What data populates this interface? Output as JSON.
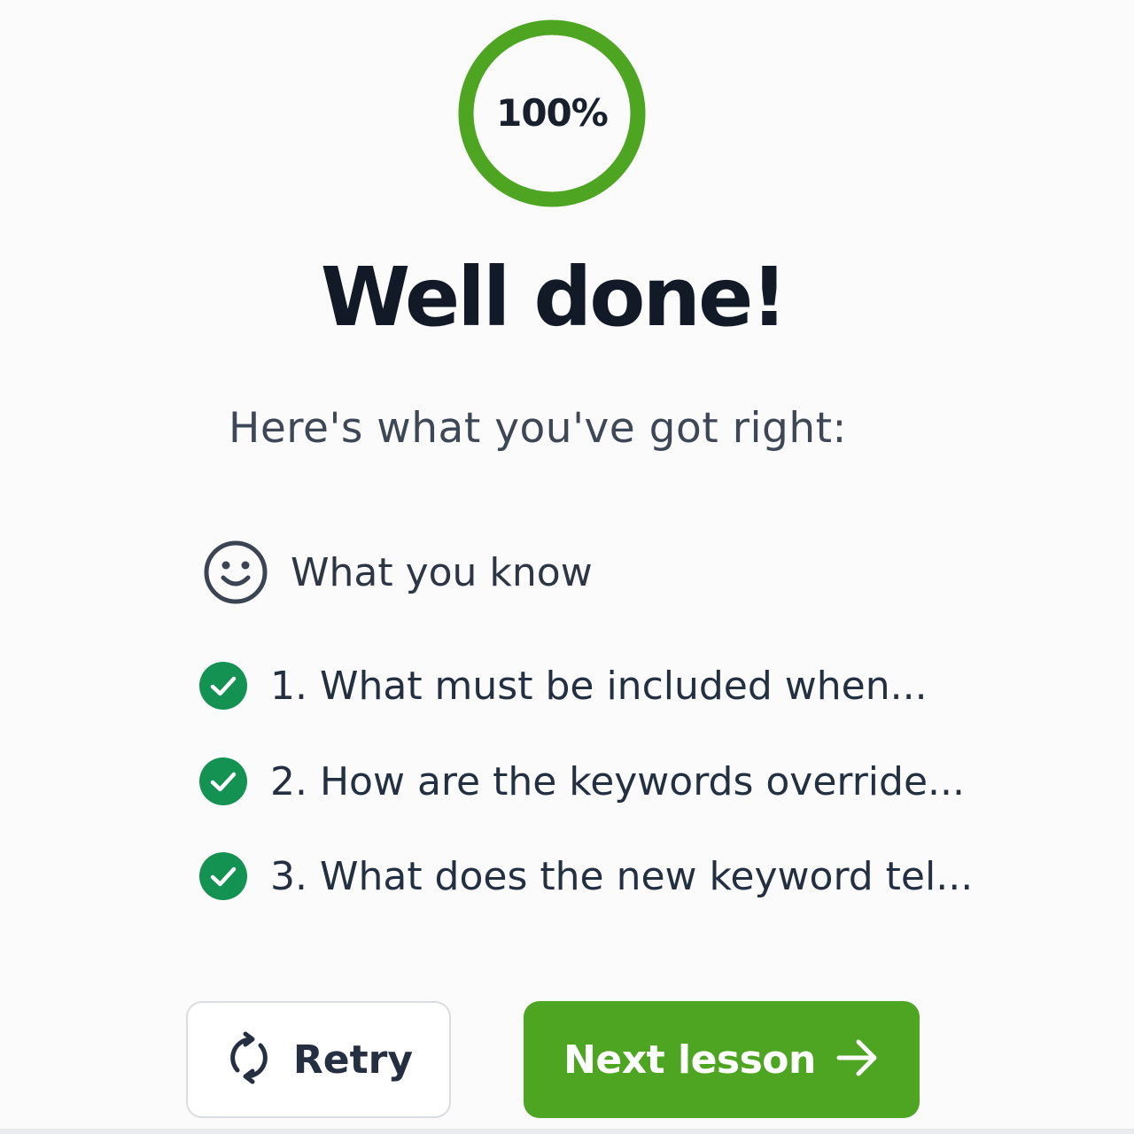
{
  "score": {
    "percent_label": "100%",
    "progress": 1.0
  },
  "heading": "Well done!",
  "subheading": "Here's what you've got right:",
  "section": {
    "label": "What you know",
    "icon": "smiley-icon"
  },
  "items": [
    {
      "label": "1. What must be included when...",
      "icon": "check-circle-icon"
    },
    {
      "label": "2. How are the keywords override...",
      "icon": "check-circle-icon"
    },
    {
      "label": "3. What does the new keyword tel...",
      "icon": "check-circle-icon"
    }
  ],
  "buttons": {
    "retry": {
      "label": "Retry",
      "icon": "refresh-icon"
    },
    "next": {
      "label": "Next lesson",
      "icon": "arrow-right-icon"
    }
  },
  "colors": {
    "ring": "#4ea521",
    "check": "#139252",
    "next_button": "#4ea521"
  }
}
